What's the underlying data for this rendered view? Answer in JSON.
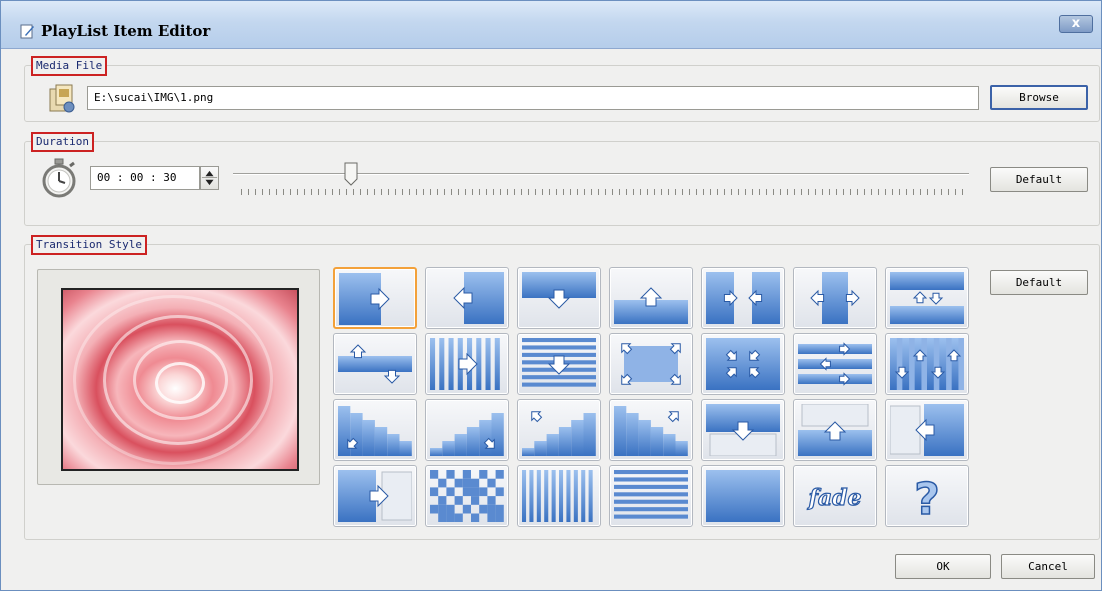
{
  "window": {
    "title": "PlayList Item Editor",
    "close_label": "x"
  },
  "media_file": {
    "legend": "Media File",
    "path": "E:\\sucai\\IMG\\1.png",
    "browse_label": "Browse"
  },
  "duration": {
    "legend": "Duration",
    "time": "00 : 00 : 30",
    "default_label": "Default",
    "slider_value_fraction": 0.16
  },
  "transition": {
    "legend": "Transition Style",
    "default_label": "Default",
    "selected_index": 0,
    "styles": [
      "push-right",
      "push-left",
      "push-down",
      "push-up",
      "split-in-horizontal",
      "split-out-horizontal",
      "split-swap",
      "push-up-down",
      "blinds-right",
      "blinds-down",
      "corners-out",
      "corners-in",
      "strips-shuffle",
      "columns-up-down",
      "stairs-down-left",
      "stairs-down-right",
      "stairs-up-left",
      "stairs-up-right",
      "cover-down",
      "cover-up",
      "cover-left",
      "cover-right",
      "checkerboard",
      "vertical-bars",
      "horizontal-bars",
      "solid-fill",
      "fade",
      "random"
    ],
    "fade_text": "fade",
    "random_text": "?"
  },
  "footer": {
    "ok_label": "OK",
    "cancel_label": "Cancel"
  },
  "colors": {
    "accent": "#3f79c9",
    "legend_highlight": "#cc2222",
    "selected_tile": "#f3a13a"
  }
}
